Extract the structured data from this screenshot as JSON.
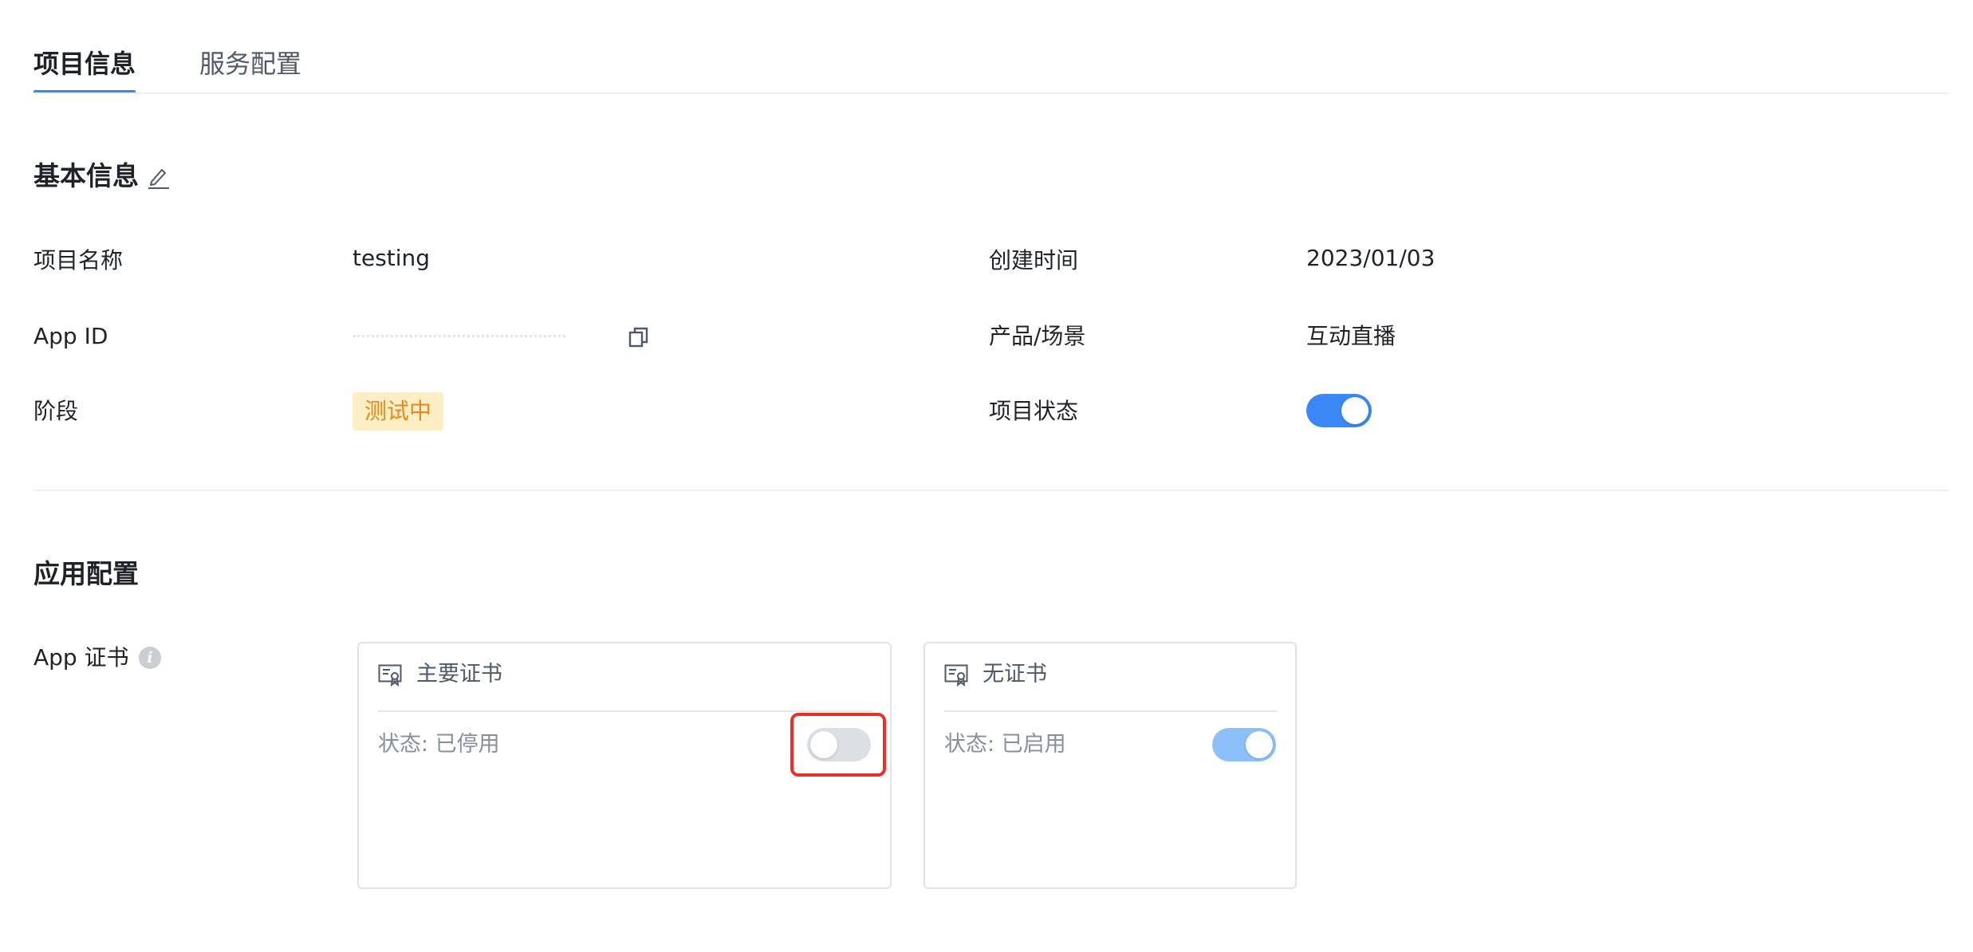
{
  "tabs": [
    {
      "label": "项目信息",
      "active": true
    },
    {
      "label": "服务配置",
      "active": false
    }
  ],
  "basic_info": {
    "title": "基本信息",
    "fields": {
      "project_name": {
        "label": "项目名称",
        "value": "testing"
      },
      "app_id": {
        "label": "App ID"
      },
      "stage": {
        "label": "阶段",
        "value": "测试中"
      },
      "created_time": {
        "label": "创建时间",
        "value": "2023/01/03"
      },
      "product_scene": {
        "label": "产品/场景",
        "value": "互动直播"
      },
      "project_status": {
        "label": "项目状态",
        "enabled": true
      }
    }
  },
  "app_config": {
    "title": "应用配置",
    "cert_label": "App 证书",
    "cards": [
      {
        "title": "主要证书",
        "status": "状态: 已停用",
        "enabled": false
      },
      {
        "title": "无证书",
        "status": "状态: 已启用",
        "enabled": true
      }
    ]
  },
  "colors": {
    "accent": "#3b87f5",
    "accent_light": "#8cc0fa",
    "toggle_off": "#dcdfe4",
    "badge_bg": "#fdeec3",
    "badge_text": "#e08a1f",
    "highlight": "#e5322d"
  },
  "icons": {
    "edit": "pencil-icon",
    "copy": "copy-icon",
    "info": "info-icon",
    "certificate": "certificate-icon"
  }
}
